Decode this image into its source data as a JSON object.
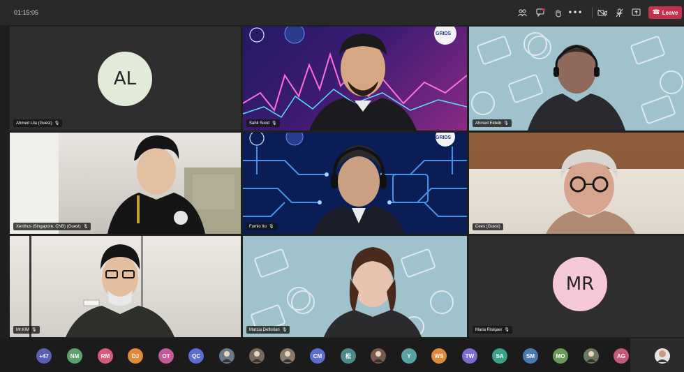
{
  "toolbar": {
    "timer": "01:15:05",
    "leave_label": "Leave",
    "icons": [
      "people-icon",
      "chat-icon",
      "raise-hand-icon",
      "more-icon",
      "camera-off-icon",
      "mic-off-icon",
      "share-icon"
    ]
  },
  "tiles": [
    {
      "name": "Ahmed Lila (Guest)",
      "initials": "AL",
      "avatar_color": "#e2ead8"
    },
    {
      "name": "Sahil Sood"
    },
    {
      "name": "Ahmed Eldeib"
    },
    {
      "name": "Xenthus (Singapore, CNB) (Guest)"
    },
    {
      "name": "Fumio Ito"
    },
    {
      "name": "Cees (Guest)"
    },
    {
      "name": "Mr.KIM"
    },
    {
      "name": "Marzia Deflorian"
    },
    {
      "name": "Maria Riskjaer",
      "initials": "MR",
      "avatar_color": "#f4c8d4"
    }
  ],
  "bg_logo": "GRIDS",
  "overflow_count": "+47",
  "participants": [
    {
      "label": "NM",
      "color": "#5aa26a"
    },
    {
      "label": "RM",
      "color": "#d65a7a"
    },
    {
      "label": "DJ",
      "color": "#e08a3a"
    },
    {
      "label": "OT",
      "color": "#c45a9c"
    },
    {
      "label": "QC",
      "color": "#5a6fd0"
    },
    {
      "label": "",
      "color": "#6b7a8a"
    },
    {
      "label": "",
      "color": "#7a6a5a"
    },
    {
      "label": "",
      "color": "#8a7a6a"
    },
    {
      "label": "CM",
      "color": "#5a6fd0"
    },
    {
      "label": "松",
      "color": "#4f8a8a"
    },
    {
      "label": "",
      "color": "#7a5a4a"
    },
    {
      "label": "Y",
      "color": "#5aa2a2"
    },
    {
      "label": "WS",
      "color": "#e08a3a"
    },
    {
      "label": "TW",
      "color": "#7a6fd0"
    },
    {
      "label": "SA",
      "color": "#3aa28a"
    },
    {
      "label": "SM",
      "color": "#4a7ab0"
    },
    {
      "label": "MO",
      "color": "#6a9a5a"
    },
    {
      "label": "",
      "color": "#6a7a5a"
    },
    {
      "label": "AG",
      "color": "#c45a7a"
    }
  ]
}
